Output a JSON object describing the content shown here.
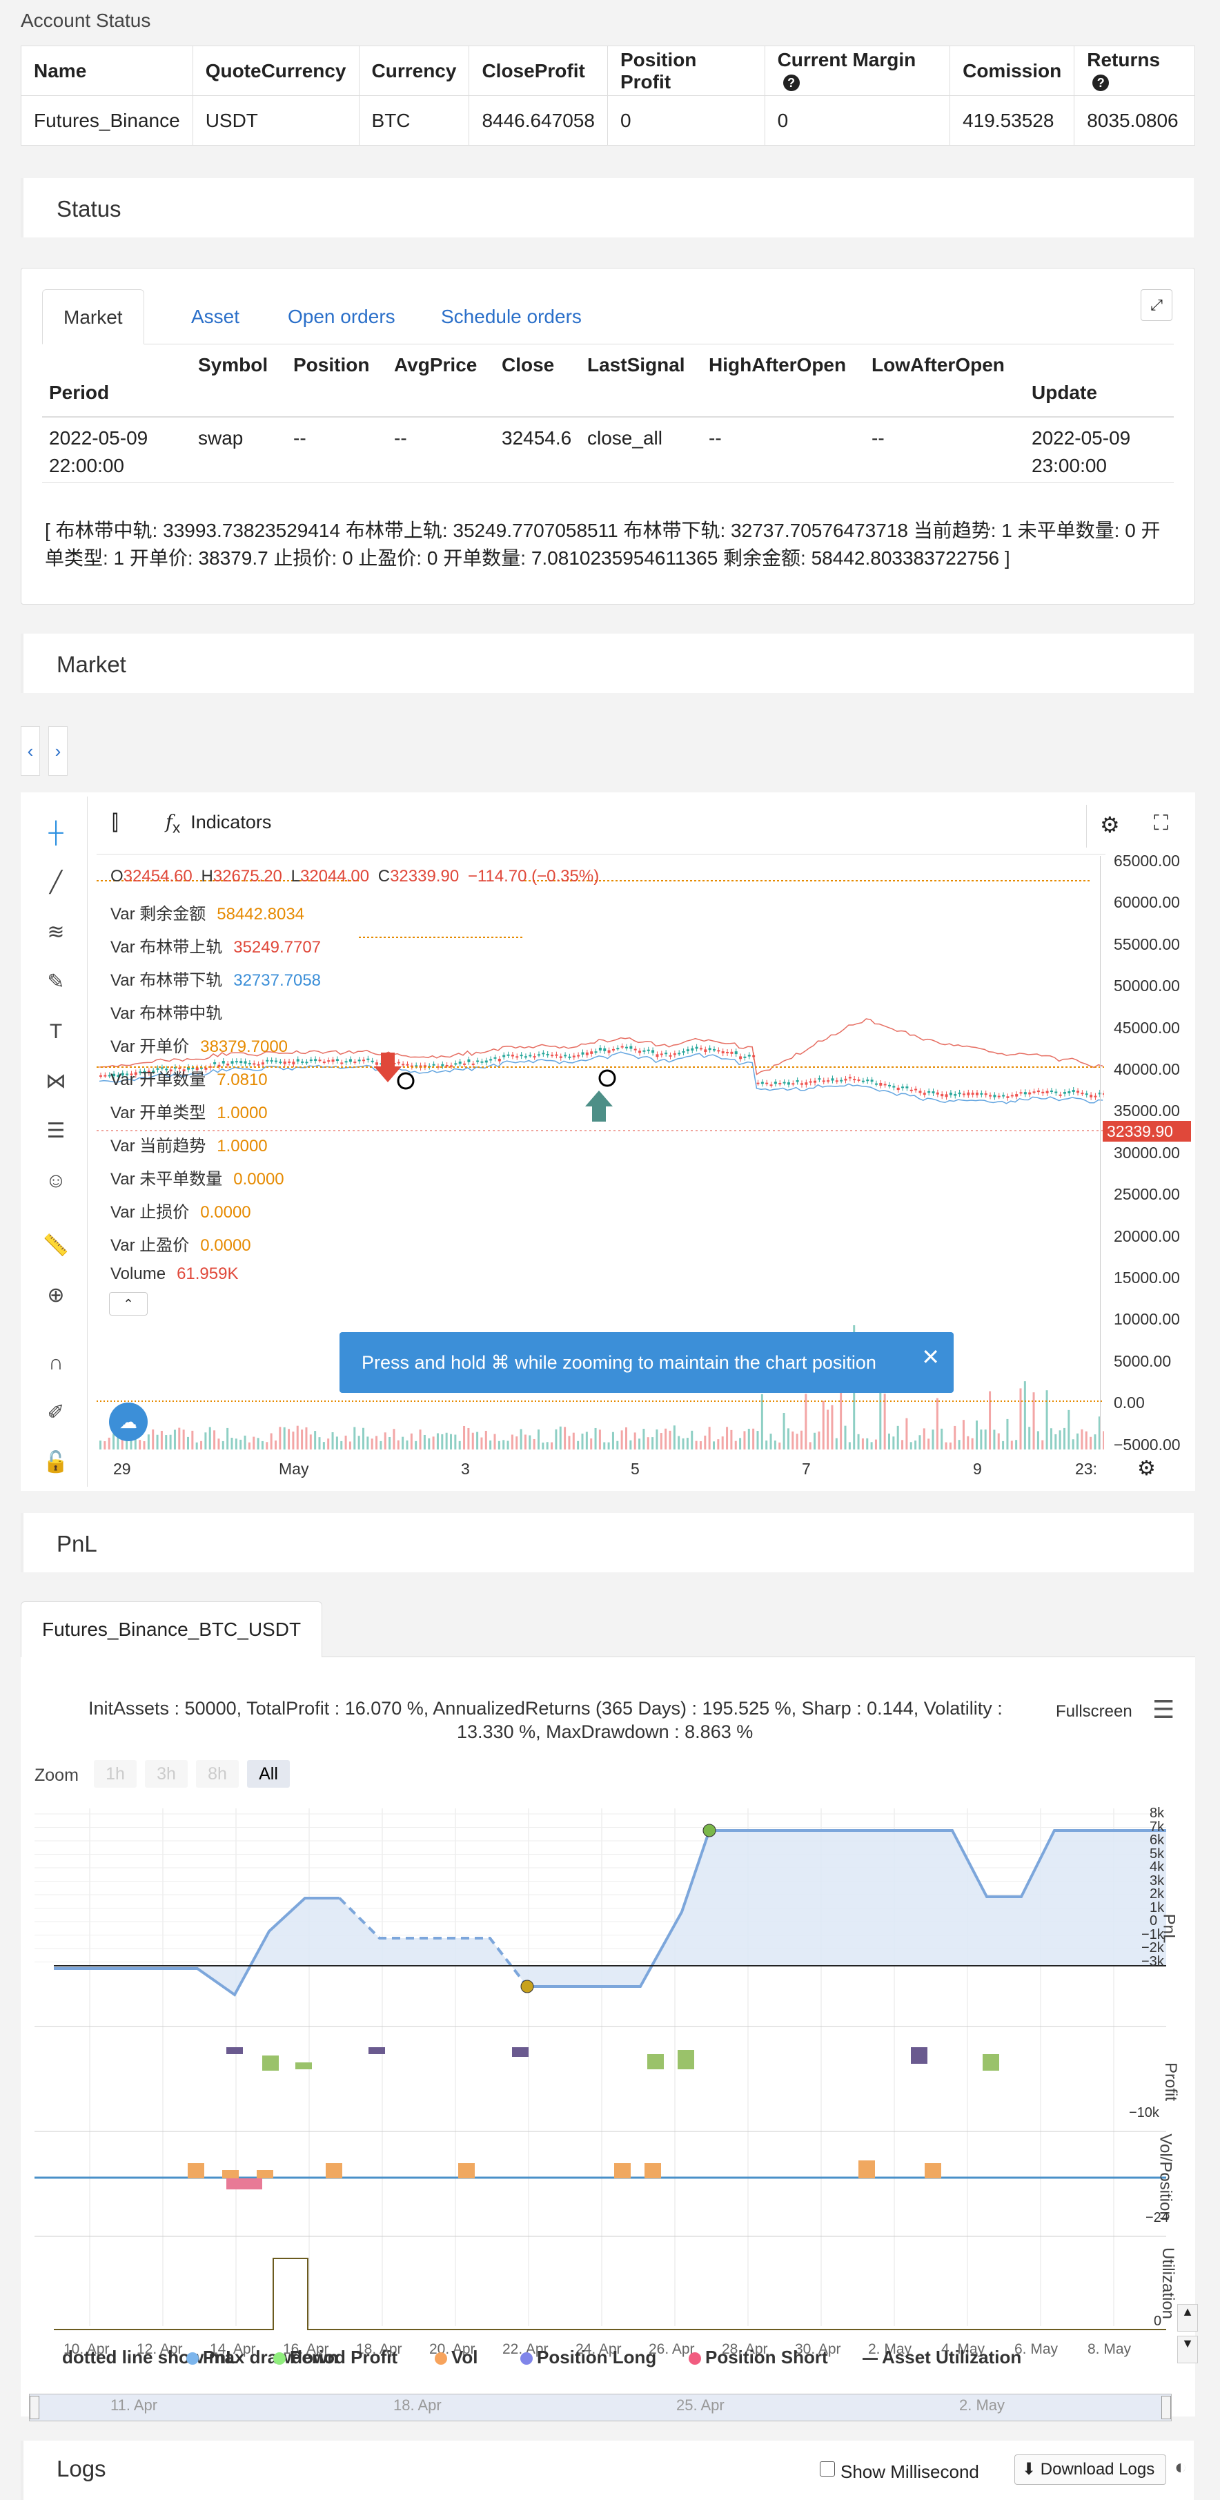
{
  "account_status": {
    "title": "Account Status",
    "headers": [
      "Name",
      "QuoteCurrency",
      "Currency",
      "CloseProfit",
      "Position Profit",
      "Current Margin",
      "Comission",
      "Returns"
    ],
    "row": [
      "Futures_Binance",
      "USDT",
      "BTC",
      "8446.647058",
      "0",
      "0",
      "419.53528",
      "8035.0806"
    ]
  },
  "status": {
    "title": "Status",
    "tabs": [
      "Market",
      "Asset",
      "Open orders",
      "Schedule orders"
    ],
    "headers": [
      "Period",
      "Symbol",
      "Position",
      "AvgPrice",
      "Close",
      "LastSignal",
      "HighAfterOpen",
      "LowAfterOpen",
      "Update"
    ],
    "row": {
      "period_line1": "2022-05-09",
      "period_line2": "22:00:00",
      "symbol": "swap",
      "position": "--",
      "avgprice": "--",
      "close": "32454.6",
      "lastsignal": "close_all",
      "highafteropen": "--",
      "lowafteropen": "--",
      "update_line1": "2022-05-09",
      "update_line2": "23:00:00"
    },
    "info_line1": "[ 布林带中轨: 33993.73823529414 布林带上轨: 35249.7707058511 布林带下轨: 32737.70576473718 当前趋势: 1 未平单数量: 0 开",
    "info_line2": "单类型: 1 开单价: 38379.7 止损价: 0 止盈价: 0 开单数量: 7.0810235954611365 剩余金额: 58442.803383722756 ]"
  },
  "market": {
    "title": "Market",
    "indicators_label": "Indicators",
    "ohlc": {
      "o_label": "O",
      "o": "32454.60",
      "h_label": "H",
      "h": "32675.20",
      "l_label": "L",
      "l": "32044.00",
      "c_label": "C",
      "c": "32339.90",
      "chg": "−114.70 (−0.35%)"
    },
    "legend": [
      {
        "label": "Var 剩余金额",
        "value": "58442.8034",
        "color": "#e68a00"
      },
      {
        "label": "Var 布林带上轨",
        "value": "35249.7707",
        "color": "#e0483a"
      },
      {
        "label": "Var 布林带下轨",
        "value": "32737.7058",
        "color": "#3c8fd8"
      },
      {
        "label": "Var 布林带中轨",
        "value": "",
        "color": "#333"
      },
      {
        "label": "Var 开单价",
        "value": "38379.7000",
        "color": "#e68a00"
      },
      {
        "label": "Var 开单数量",
        "value": "7.0810",
        "color": "#e68a00"
      },
      {
        "label": "Var 开单类型",
        "value": "1.0000",
        "color": "#e68a00"
      },
      {
        "label": "Var 当前趋势",
        "value": "1.0000",
        "color": "#e68a00"
      },
      {
        "label": "Var 未平单数量",
        "value": "0.0000",
        "color": "#e68a00"
      },
      {
        "label": "Var 止损价",
        "value": "0.0000",
        "color": "#e68a00"
      },
      {
        "label": "Var 止盈价",
        "value": "0.0000",
        "color": "#e68a00"
      },
      {
        "label": "Volume",
        "value": "61.959K",
        "color": "#e0483a"
      }
    ],
    "y_ticks": [
      "65000.00",
      "60000.00",
      "55000.00",
      "50000.00",
      "45000.00",
      "40000.00",
      "35000.00",
      "30000.00",
      "25000.00",
      "20000.00",
      "15000.00",
      "10000.00",
      "5000.00",
      "0.00",
      "−5000.00"
    ],
    "x_ticks": [
      "29",
      "May",
      "3",
      "5",
      "7",
      "9",
      "23:"
    ],
    "price_label": "32339.90",
    "tooltip": "Press and hold ⌘ while zooming to maintain the chart position"
  },
  "pnl": {
    "title": "PnL",
    "tab": "Futures_Binance_BTC_USDT",
    "summary_line1": "InitAssets : 50000, TotalProfit : 16.070 %, AnnualizedReturns (365 Days) : 195.525 %, Sharp : 0.144, Volatility :",
    "summary_line2": "13.330 %, MaxDrawdown : 8.863 %",
    "fullscreen": "Fullscreen",
    "zoom_label": "Zoom",
    "zoom_buttons": [
      "1h",
      "3h",
      "8h",
      "All"
    ],
    "pnl_ticks": [
      "8k",
      "7k",
      "6k",
      "5k",
      "4k",
      "3k",
      "2k",
      "1k",
      "0",
      "−1k",
      "−2k",
      "−3k"
    ],
    "profit_tick": "−10k",
    "vol_tick": "−24",
    "util_tick": "0",
    "axis_titles": [
      "PnL",
      "Profit",
      "Vol/Position",
      "Utilization"
    ],
    "x_dates": [
      "10. Apr",
      "12. Apr",
      "14. Apr",
      "16. Apr",
      "18. Apr",
      "20. Apr",
      "22. Apr",
      "24. Apr",
      "26. Apr",
      "28. Apr",
      "30. Apr",
      "2. May",
      "4. May",
      "6. May",
      "8. May"
    ],
    "nav_dates": [
      "11. Apr",
      "18. Apr",
      "25. Apr",
      "2. May"
    ],
    "legend": [
      {
        "label": "dotted line show max drawdown",
        "color": "#999"
      },
      {
        "label": "PnL",
        "color": "#7cb5ec"
      },
      {
        "label": "Period Profit",
        "color": "#90ed7d"
      },
      {
        "label": "Vol",
        "color": "#f7a35c"
      },
      {
        "label": "Position Long",
        "color": "#8085e9"
      },
      {
        "label": "Position Short",
        "color": "#f15c80"
      },
      {
        "label": "Asset Utilization",
        "color": "#444"
      }
    ]
  },
  "logs": {
    "title": "Logs",
    "show_ms": "Show Millisecond",
    "download": "Download Logs"
  }
}
